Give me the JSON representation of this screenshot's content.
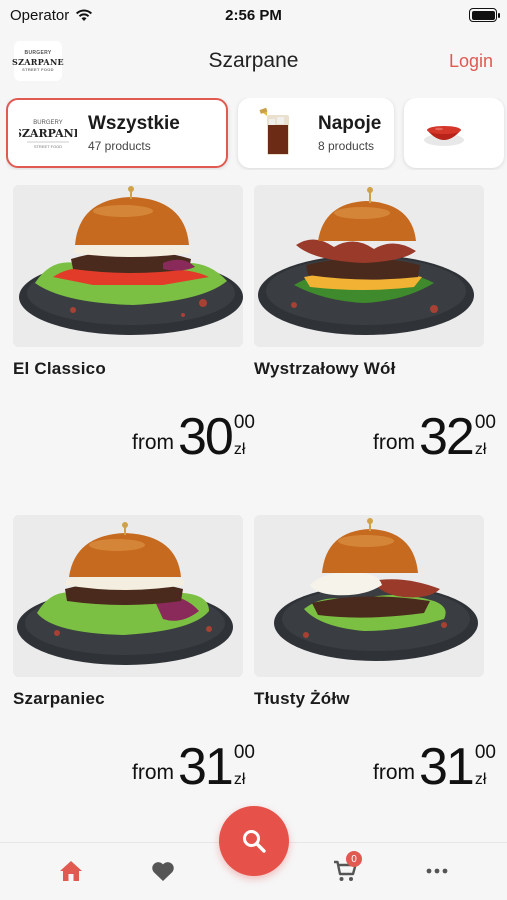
{
  "status_bar": {
    "carrier": "Operator",
    "time": "2:56 PM",
    "battery_level": 1.0
  },
  "header": {
    "logo_text_top": "BURGERY",
    "logo_text_main": "SZARPANE",
    "logo_text_bottom": "STREET FOOD",
    "title": "Szarpane",
    "login_label": "Login"
  },
  "categories": [
    {
      "name": "Wszystkie",
      "count": "47 products",
      "icon": "logo-icon",
      "selected": true
    },
    {
      "name": "Napoje",
      "count": "8 products",
      "icon": "drink-icon",
      "selected": false
    },
    {
      "name": "",
      "count": "",
      "icon": "sauce-bowl-icon",
      "selected": false
    }
  ],
  "products": [
    {
      "name": "El Classico",
      "price_prefix": "from",
      "price_int": "30",
      "price_frac": "00",
      "currency": "zł"
    },
    {
      "name": "Wystrzałowy Wół",
      "price_prefix": "from",
      "price_int": "32",
      "price_frac": "00",
      "currency": "zł"
    },
    {
      "name": "Szarpaniec",
      "price_prefix": "from",
      "price_int": "31",
      "price_frac": "00",
      "currency": "zł"
    },
    {
      "name": "Tłusty Żółw",
      "price_prefix": "from",
      "price_int": "31",
      "price_frac": "00",
      "currency": "zł"
    }
  ],
  "bottom_nav": {
    "items": [
      "home-icon",
      "heart-icon",
      "cart-icon",
      "more-icon"
    ],
    "active": "home-icon",
    "cart_count": "0",
    "fab_icon": "search-icon"
  },
  "colors": {
    "accent": "#e05a52",
    "background": "#f6f6f7",
    "inactive_icon": "#555555"
  }
}
